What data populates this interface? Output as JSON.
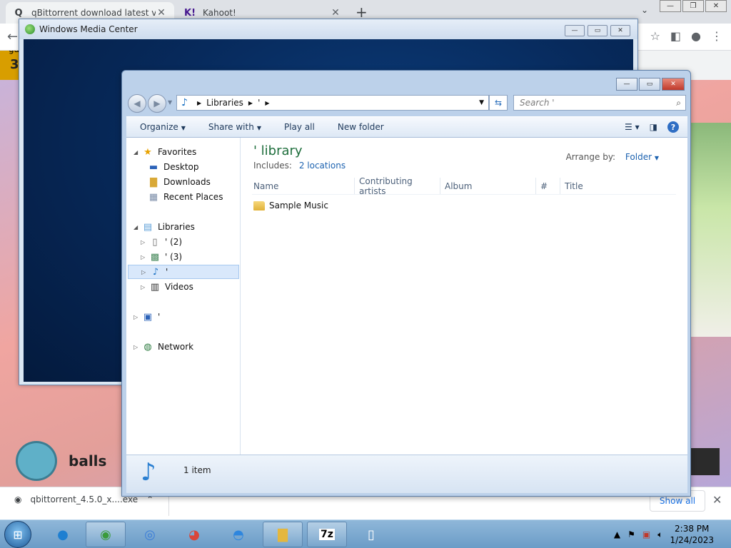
{
  "browser": {
    "tabs": [
      {
        "favicon": "Q",
        "title": "qBittorrent download latest versi"
      },
      {
        "favicon": "K!",
        "title": "Kahoot!"
      }
    ],
    "page_header_text": "3"
  },
  "kahoot": {
    "answer_yellow": "gas",
    "answer_bottom": "balls"
  },
  "download_bar": {
    "file_name": "qbittorrent_4.5.0_x....exe",
    "show_all_label": "Show all"
  },
  "wmc": {
    "title": "Windows Media Center"
  },
  "explorer": {
    "breadcrumb": [
      "Libraries",
      "'"
    ],
    "search_placeholder": "Search '",
    "commands": [
      "Organize",
      "Share with",
      "Play all",
      "New folder"
    ],
    "nav": {
      "favorites_label": "Favorites",
      "favorites": [
        "Desktop",
        "Downloads",
        "Recent Places"
      ],
      "libraries_label": "Libraries",
      "libraries": [
        "' (2)",
        "' (3)",
        "'",
        "Videos"
      ],
      "computer_label": "'",
      "network_label": "Network"
    },
    "library_title": "' library",
    "includes_label": "Includes:",
    "includes_link": "2 locations",
    "arrange_label": "Arrange by:",
    "arrange_value": "Folder",
    "columns": [
      "Name",
      "Contributing artists",
      "Album",
      "#",
      "Title"
    ],
    "items": [
      {
        "name": "Sample Music"
      }
    ],
    "status_count": "1 item"
  },
  "taskbar": {
    "time": "2:38 PM",
    "date": "1/24/2023"
  }
}
